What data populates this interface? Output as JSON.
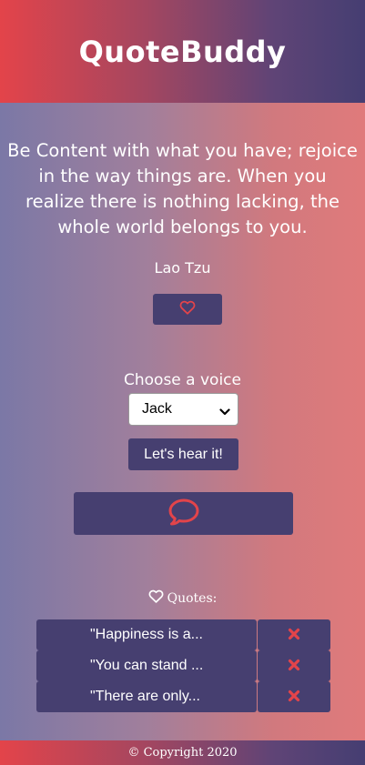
{
  "header": {
    "title": "QuoteBuddy"
  },
  "quote": {
    "text": "Be Content with what you have; rejoice in the way things are. When you realize there is nothing lacking, the whole world belongs to you.",
    "author": "Lao Tzu"
  },
  "like_button": {
    "icon": "heart-outline-icon"
  },
  "voice": {
    "label": "Choose a voice",
    "selected": "Jack"
  },
  "hear_button": {
    "label": "Let's hear it!"
  },
  "speak_button": {
    "icon": "speech-bubble-icon"
  },
  "favorites": {
    "title": "Quotes:",
    "icon": "heart-outline-icon",
    "items": [
      {
        "text": "\"Happiness is a..."
      },
      {
        "text": "\"You can stand ..."
      },
      {
        "text": "\"There are only..."
      }
    ]
  },
  "footer": {
    "text": "© Copyright 2020"
  },
  "colors": {
    "accent": "#e3444a",
    "button": "#463f70"
  }
}
